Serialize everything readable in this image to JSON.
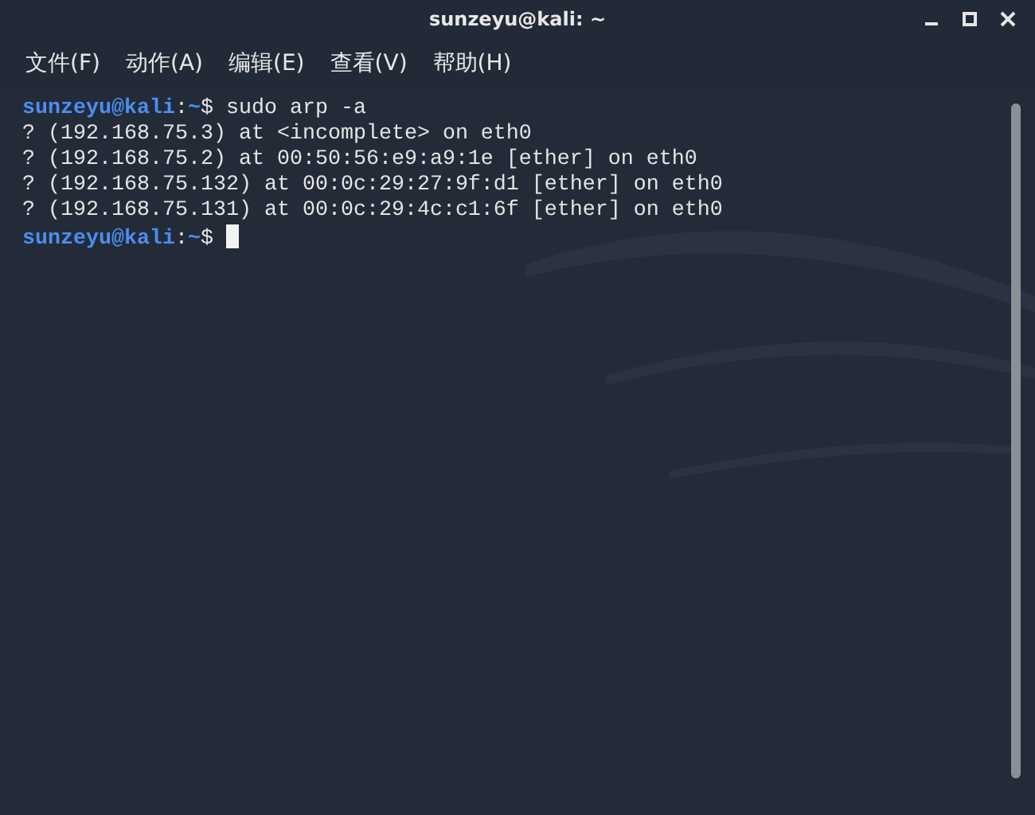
{
  "window": {
    "title": "sunzeyu@kali: ~"
  },
  "menu": [
    {
      "label": "文件(F)"
    },
    {
      "label": "动作(A)"
    },
    {
      "label": "编辑(E)"
    },
    {
      "label": "查看(V)"
    },
    {
      "label": "帮助(H)"
    }
  ],
  "terminal": {
    "lines": [
      {
        "kind": "prompt",
        "user": "sunzeyu@kali",
        "sep": ":",
        "path": "~",
        "sign": "$",
        "command": " sudo arp -a"
      },
      {
        "kind": "output",
        "text": "? (192.168.75.3) at <incomplete> on eth0"
      },
      {
        "kind": "output",
        "text": "? (192.168.75.2) at 00:50:56:e9:a9:1e [ether] on eth0"
      },
      {
        "kind": "output",
        "text": "? (192.168.75.132) at 00:0c:29:27:9f:d1 [ether] on eth0"
      },
      {
        "kind": "output",
        "text": "? (192.168.75.131) at 00:0c:29:4c:c1:6f [ether] on eth0"
      },
      {
        "kind": "prompt",
        "user": "sunzeyu@kali",
        "sep": ":",
        "path": "~",
        "sign": "$",
        "cursor": true
      }
    ]
  }
}
